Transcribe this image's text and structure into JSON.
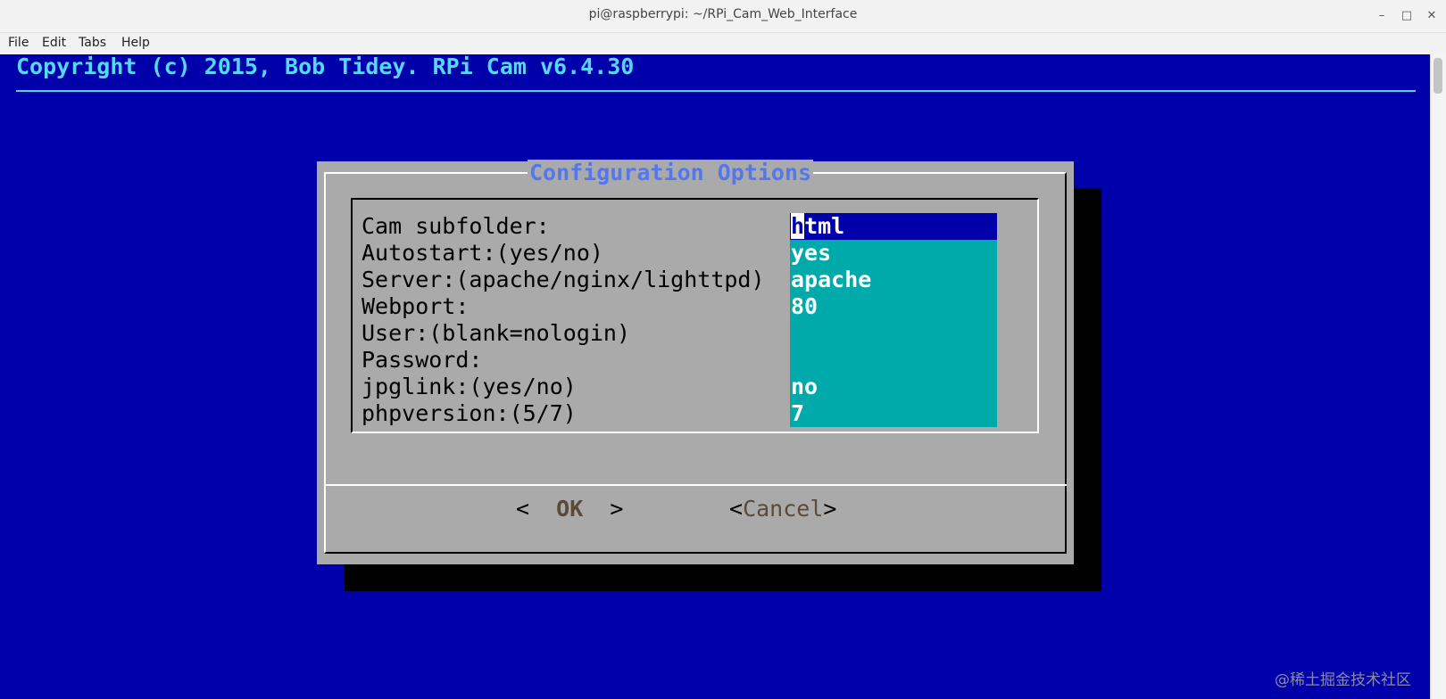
{
  "window": {
    "title": "pi@raspberrypi: ~/RPi_Cam_Web_Interface",
    "minimize": "–",
    "maximize": "□",
    "close": "✕"
  },
  "menu": [
    "File",
    "Edit",
    "Tabs",
    "Help"
  ],
  "terminal": {
    "backtitle": "Copyright (c) 2015, Bob Tidey. RPi Cam v6.4.30",
    "background": "#0000aa"
  },
  "dialog": {
    "title": "Configuration Options",
    "fields": [
      {
        "label": "Cam subfolder:",
        "value": "html",
        "active": true
      },
      {
        "label": "Autostart:(yes/no)",
        "value": "yes"
      },
      {
        "label": "Server:(apache/nginx/lighttpd)",
        "value": "apache"
      },
      {
        "label": "Webport:",
        "value": "80"
      },
      {
        "label": "User:(blank=nologin)",
        "value": ""
      },
      {
        "label": "Password:",
        "value": ""
      },
      {
        "label": "jpglink:(yes/no)",
        "value": "no"
      },
      {
        "label": "phpversion:(5/7)",
        "value": "7"
      }
    ],
    "buttons": {
      "ok_left": "<  ",
      "ok_label": "OK",
      "ok_right": "  >",
      "cancel_left": "<",
      "cancel_label": "Cancel",
      "cancel_right": ">"
    }
  },
  "colors": {
    "dialog_bg": "#aaaaaa",
    "field_bg": "#00aaaa",
    "active_field_bg": "#0000aa",
    "title_fg": "#5577ee",
    "backtitle_fg": "#55d7ff"
  },
  "watermark": "@稀土掘金技术社区"
}
